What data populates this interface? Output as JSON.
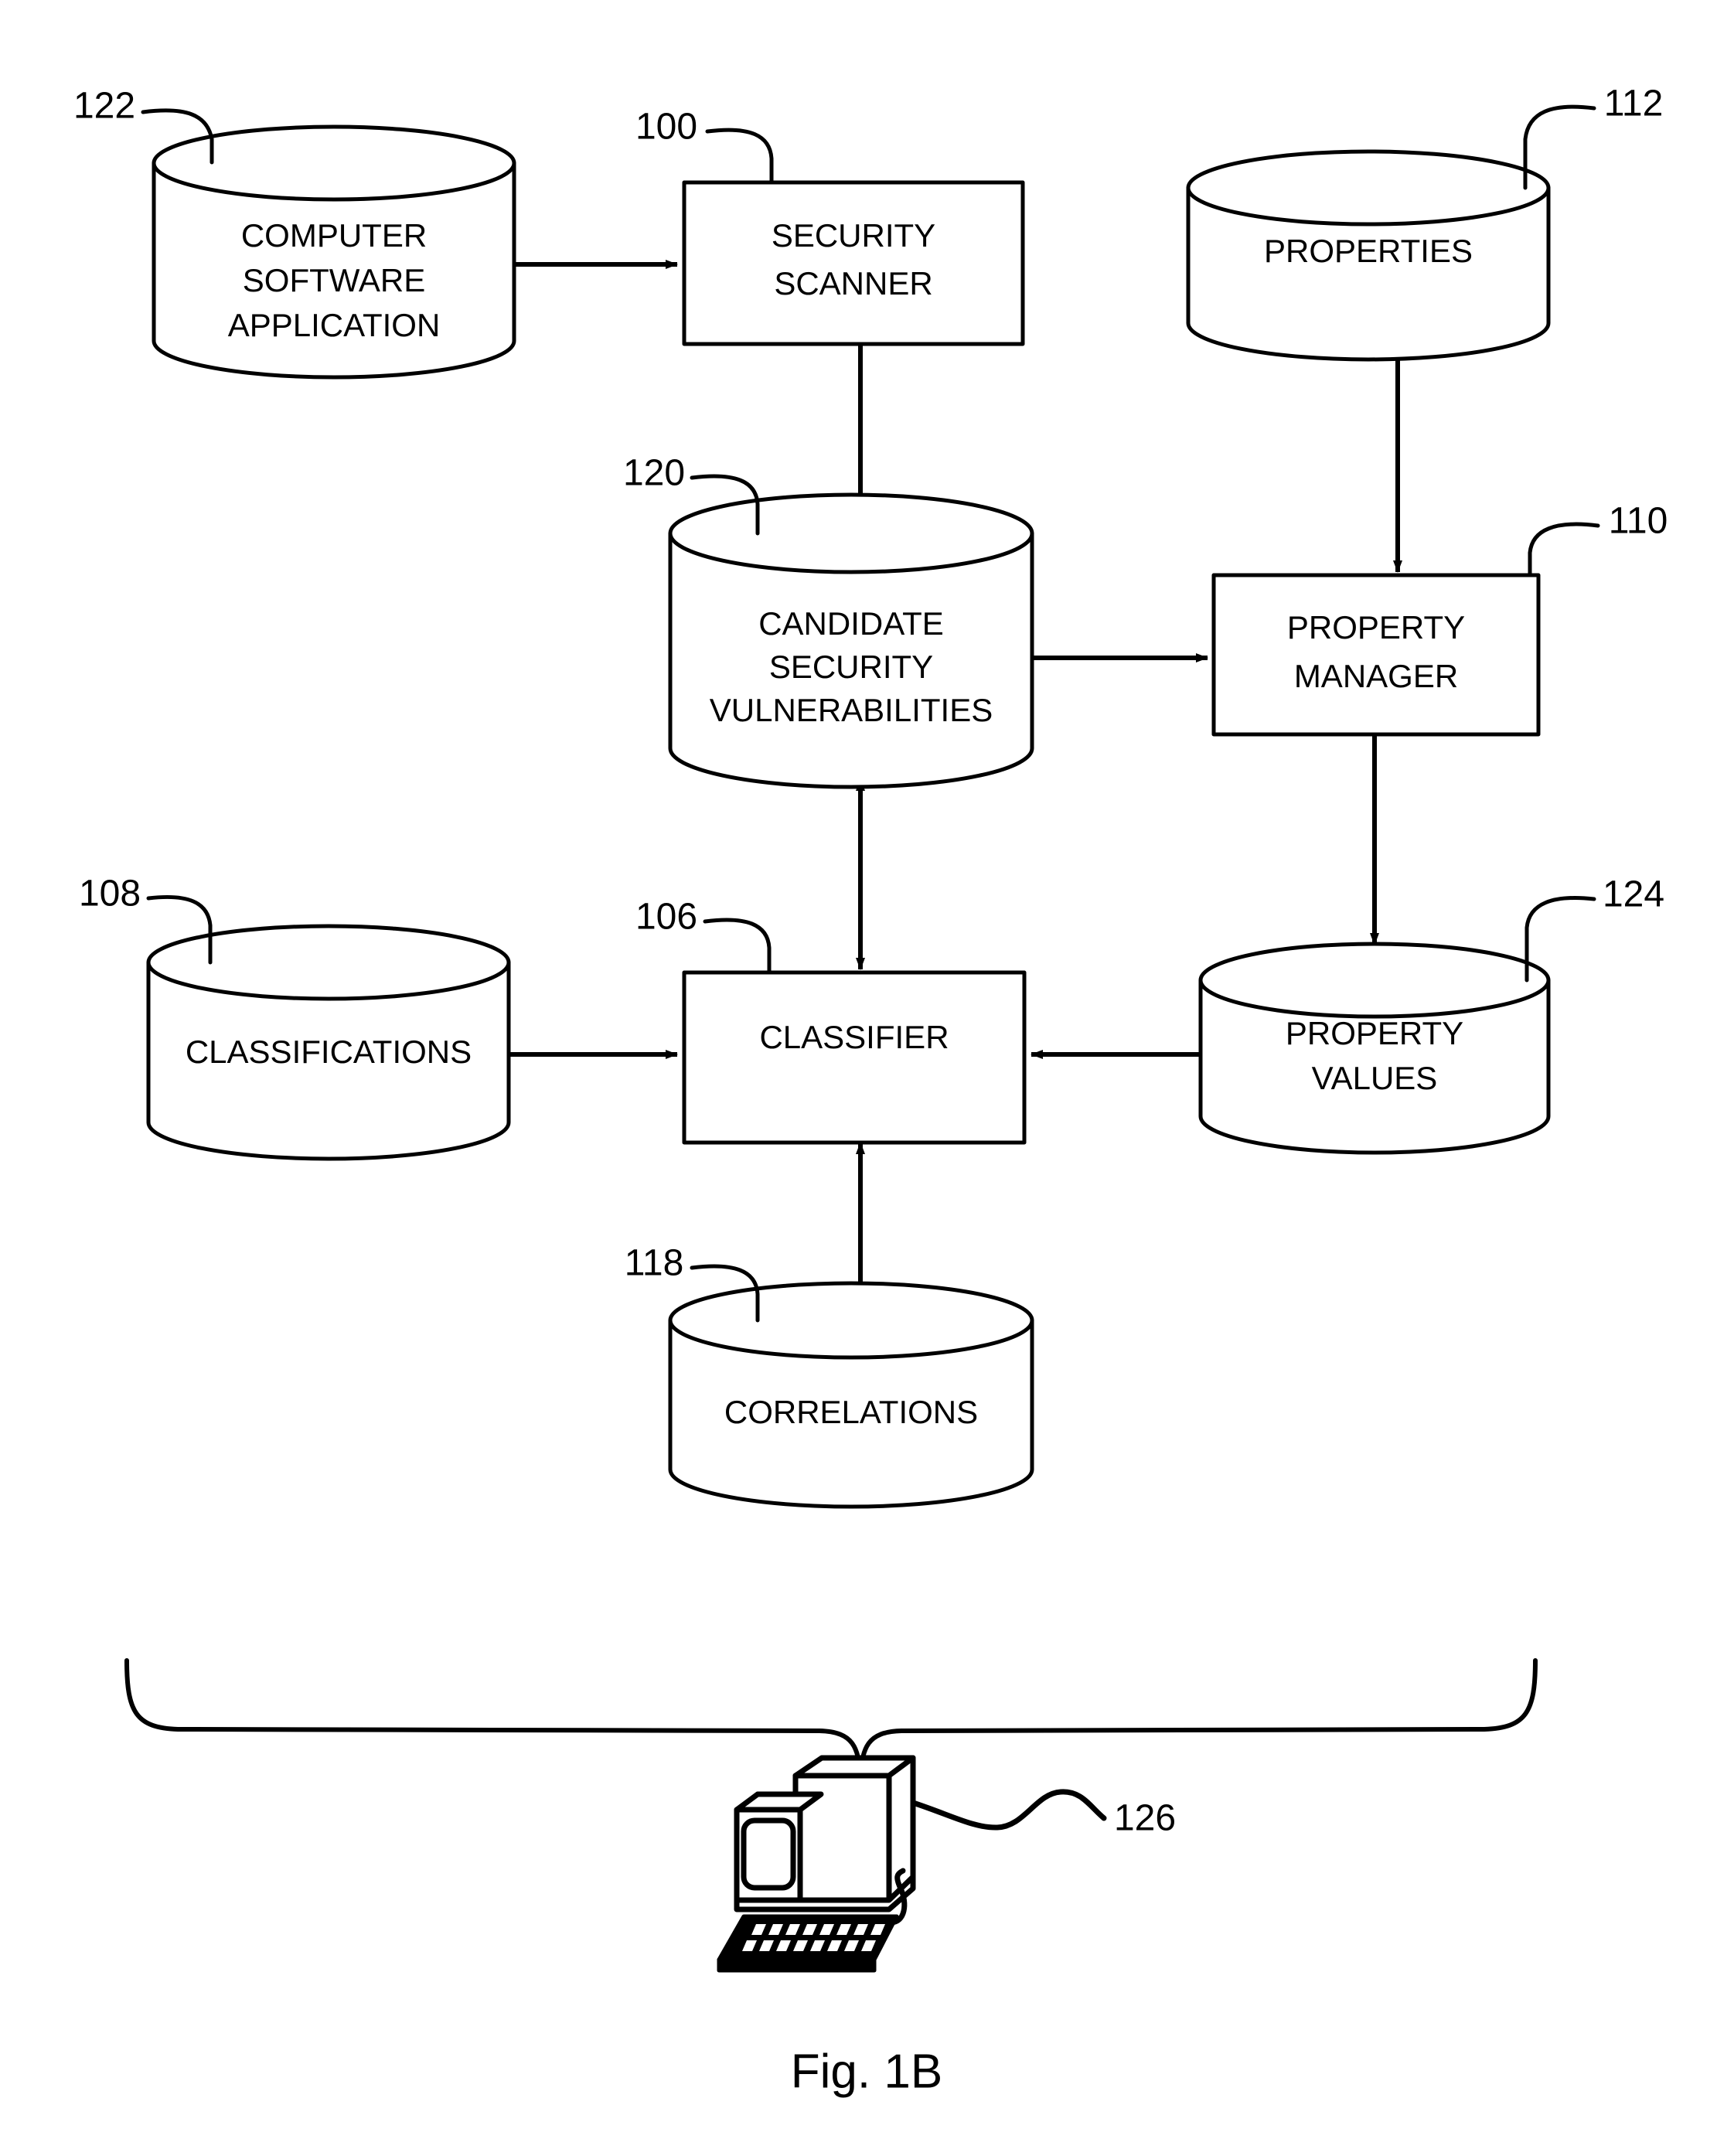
{
  "figure": {
    "caption": "Fig. 1B"
  },
  "nodes": [
    {
      "id": "computer-software-application",
      "shape": "cylinder",
      "ref": "122",
      "lines": [
        "COMPUTER",
        "SOFTWARE",
        "APPLICATION"
      ]
    },
    {
      "id": "security-scanner",
      "shape": "rectangle",
      "ref": "100",
      "lines": [
        "SECURITY",
        "SCANNER"
      ]
    },
    {
      "id": "properties",
      "shape": "cylinder",
      "ref": "112",
      "lines": [
        "PROPERTIES"
      ]
    },
    {
      "id": "candidate-security-vulnerabilities",
      "shape": "cylinder",
      "ref": "120",
      "lines": [
        "CANDIDATE",
        "SECURITY",
        "VULNERABILITIES"
      ]
    },
    {
      "id": "property-manager",
      "shape": "rectangle",
      "ref": "110",
      "lines": [
        "PROPERTY",
        "MANAGER"
      ]
    },
    {
      "id": "classifications",
      "shape": "cylinder",
      "ref": "108",
      "lines": [
        "CLASSIFICATIONS"
      ]
    },
    {
      "id": "classifier",
      "shape": "rectangle",
      "ref": "106",
      "lines": [
        "CLASSIFIER"
      ]
    },
    {
      "id": "property-values",
      "shape": "cylinder",
      "ref": "124",
      "lines": [
        "PROPERTY",
        "VALUES"
      ]
    },
    {
      "id": "correlations",
      "shape": "cylinder",
      "ref": "118",
      "lines": [
        "CORRELATIONS"
      ]
    },
    {
      "id": "computer-system",
      "shape": "computer-icon",
      "ref": "126",
      "lines": []
    }
  ],
  "labels": {
    "csa_line1": "COMPUTER",
    "csa_line2": "SOFTWARE",
    "csa_line3": "APPLICATION",
    "scanner_line1": "SECURITY",
    "scanner_line2": "SCANNER",
    "properties_line1": "PROPERTIES",
    "csv_line1": "CANDIDATE",
    "csv_line2": "SECURITY",
    "csv_line3": "VULNERABILITIES",
    "pm_line1": "PROPERTY",
    "pm_line2": "MANAGER",
    "classifications_line1": "CLASSIFICATIONS",
    "classifier_line1": "CLASSIFIER",
    "pv_line1": "PROPERTY",
    "pv_line2": "VALUES",
    "correlations_line1": "CORRELATIONS"
  },
  "refs": {
    "csa": "122",
    "scanner": "100",
    "properties": "112",
    "csv": "120",
    "property_manager": "110",
    "classifications": "108",
    "classifier": "106",
    "property_values": "124",
    "correlations": "118",
    "computer": "126"
  },
  "connections": [
    {
      "from": "computer-software-application",
      "to": "security-scanner",
      "direction": "one-way"
    },
    {
      "from": "security-scanner",
      "to": "candidate-security-vulnerabilities",
      "direction": "one-way"
    },
    {
      "from": "properties",
      "to": "property-manager",
      "direction": "one-way"
    },
    {
      "from": "candidate-security-vulnerabilities",
      "to": "property-manager",
      "direction": "one-way"
    },
    {
      "from": "property-manager",
      "to": "property-values",
      "direction": "one-way"
    },
    {
      "from": "candidate-security-vulnerabilities",
      "to": "classifier",
      "direction": "two-way"
    },
    {
      "from": "classifications",
      "to": "classifier",
      "direction": "one-way"
    },
    {
      "from": "property-values",
      "to": "classifier",
      "direction": "one-way"
    },
    {
      "from": "correlations",
      "to": "classifier",
      "direction": "one-way"
    }
  ],
  "colors": {
    "ink": "#000000",
    "background": "#ffffff"
  }
}
